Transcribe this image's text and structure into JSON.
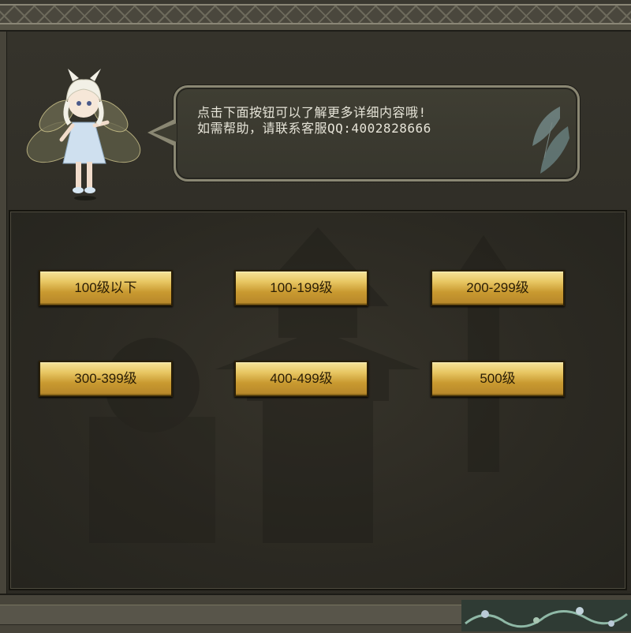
{
  "dialog": {
    "line1": "点击下面按钮可以了解更多详细内容哦!",
    "line2": "如需帮助，请联系客服QQ:4002828666"
  },
  "levels": {
    "btn1": "100级以下",
    "btn2": "100-199级",
    "btn3": "200-299级",
    "btn4": "300-399级",
    "btn5": "400-499级",
    "btn6": "500级"
  },
  "colors": {
    "button_gold": "#e8c764",
    "panel_bg": "#2b2922",
    "bubble_border": "#8a8773",
    "text_light": "#e6e4d8"
  },
  "icons": {
    "mascot": "fairy-mascot-icon",
    "pagoda": "pagoda-watermark-icon",
    "butterfly": "butterfly-deco-icon"
  }
}
